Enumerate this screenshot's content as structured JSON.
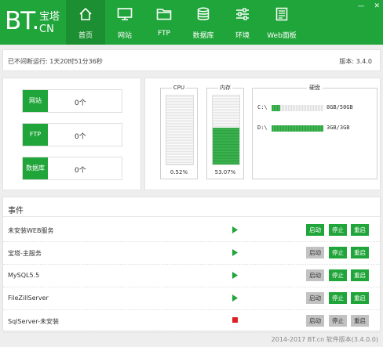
{
  "brand": {
    "logo_main": "BT.",
    "logo_cn_top": "宝塔",
    "logo_cn_bottom": "CN"
  },
  "nav": [
    {
      "label": "首页",
      "icon": "home-icon",
      "active": true
    },
    {
      "label": "网站",
      "icon": "monitor-icon",
      "active": false
    },
    {
      "label": "FTP",
      "icon": "folder-icon",
      "active": false
    },
    {
      "label": "数据库",
      "icon": "database-icon",
      "active": false
    },
    {
      "label": "环境",
      "icon": "sliders-icon",
      "active": false
    },
    {
      "label": "Web面板",
      "icon": "document-icon",
      "active": false
    }
  ],
  "window": {
    "minimize": "—",
    "close": "✕"
  },
  "status": {
    "uptime": "已不间断运行: 1天20时51分36秒",
    "version": "版本: 3.4.0"
  },
  "stats": [
    {
      "label": "网站",
      "value": "0个"
    },
    {
      "label": "FTP",
      "value": "0个"
    },
    {
      "label": "数据库",
      "value": "0个"
    }
  ],
  "resources": {
    "cpu": {
      "label": "CPU",
      "percent_text": "0.52%",
      "fraction": 0.0052
    },
    "memory": {
      "label": "内存",
      "percent_text": "53.07%",
      "fraction": 0.5307
    },
    "disk": {
      "label": "硬盘",
      "drives": [
        {
          "name": "C:\\",
          "size": "8GB/50GB",
          "fraction": 0.16
        },
        {
          "name": "D:\\",
          "size": "3GB/3GB",
          "fraction": 1.0
        }
      ]
    }
  },
  "events": {
    "title": "事件",
    "buttons": {
      "start": "启动",
      "stop": "停止",
      "restart": "重启"
    },
    "services": [
      {
        "name": "未安装WEB服务",
        "state": "running",
        "start_enabled": true,
        "stop_enabled": true,
        "restart_enabled": true
      },
      {
        "name": "宝塔-主服务",
        "state": "running",
        "start_enabled": false,
        "stop_enabled": true,
        "restart_enabled": true
      },
      {
        "name": "MySQL5.5",
        "state": "running",
        "start_enabled": false,
        "stop_enabled": true,
        "restart_enabled": true
      },
      {
        "name": "FileZillServer",
        "state": "running",
        "start_enabled": false,
        "stop_enabled": true,
        "restart_enabled": true
      },
      {
        "name": "SqlServer-未安装",
        "state": "stopped",
        "start_enabled": false,
        "stop_enabled": false,
        "restart_enabled": false
      }
    ]
  },
  "colors": {
    "accent": "#20a53a",
    "running": "#20a53a",
    "stopped": "#e02020",
    "disabled": "#c2c2c2"
  },
  "footer": "2014-2017 BT.cn  软件版本(3.4.0.0)"
}
